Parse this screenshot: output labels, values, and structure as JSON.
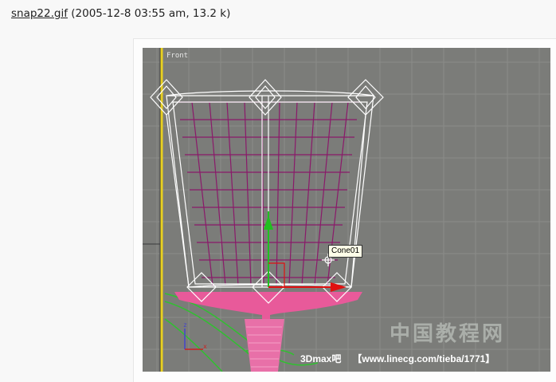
{
  "caption": {
    "filename": "snap22.gif",
    "meta": " (2005-12-8 03:55 am, 13.2 k)"
  },
  "viewport": {
    "label": "Front",
    "tooltip": "Cone01",
    "axis_z": "z",
    "axis_x": "x"
  },
  "watermark": {
    "site_cn": "中国教程网",
    "tag": "3Dmax吧",
    "url": "【www.linecg.com/tieba/1771】"
  },
  "colors": {
    "viewport_bg": "#7b7c79",
    "grid": "#8b8c89",
    "wire": "#ffffff",
    "mesh": "#8a1a6a",
    "base": "#e85a9a",
    "accent_yellow": "#e8d020",
    "gizmo_green": "#20c020",
    "gizmo_red": "#e01010"
  }
}
